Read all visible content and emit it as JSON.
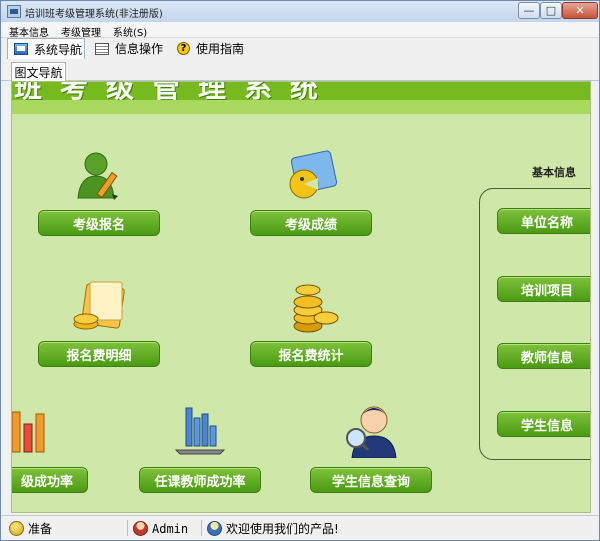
{
  "window": {
    "title": "培训班考级管理系统(非注册版)"
  },
  "window_controls": {
    "minimize": "—",
    "maximize": "□",
    "close": "✕"
  },
  "menu": [
    "基本信息",
    "考级管理",
    "系统(S)"
  ],
  "toolbar_tabs": [
    {
      "label": "系统导航",
      "icon": "monitor-icon"
    },
    {
      "label": "信息操作",
      "icon": "document-icon"
    },
    {
      "label": "使用指南",
      "icon": "help-icon"
    }
  ],
  "subtab": "图文导航",
  "banner": {
    "title": "班考级管理系统"
  },
  "nav_buttons": {
    "register": "考级报名",
    "scores": "考级成绩",
    "fee_detail": "报名费明细",
    "fee_stats": "报名费统计",
    "pass_rate": "级成功率",
    "teacher_rate": "任课教师成功率",
    "student_query": "学生信息查询"
  },
  "basic_info": {
    "label": "基本信息",
    "buttons": [
      "单位名称",
      "培训项目",
      "教师信息",
      "学生信息"
    ]
  },
  "statusbar": {
    "status": "准备",
    "user": "Admin",
    "message": "欢迎使用我们的产品!"
  },
  "colors": {
    "panel_bg": "#cfe7a8",
    "button_green": "#5aa81e",
    "banner": "#77ba1f"
  }
}
